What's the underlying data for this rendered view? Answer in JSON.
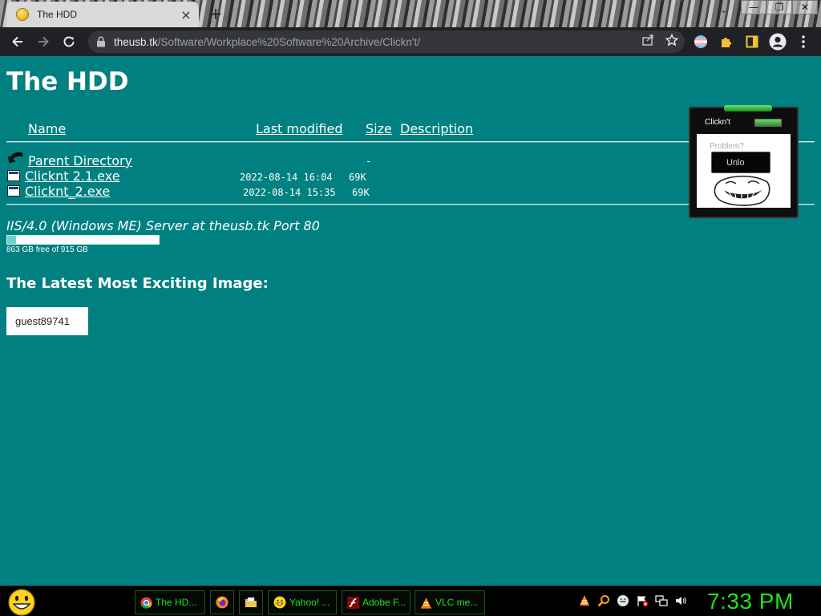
{
  "browser": {
    "tab_title": "The HDD",
    "tab_close": "×",
    "new_tab": "+",
    "url_host": "theusb.tk",
    "url_path": "/Software/Workplace%20Software%20Archive/Clickn't/"
  },
  "window_controls": {
    "minimize": "—",
    "maximize": "❐",
    "close": "✕"
  },
  "page": {
    "title": "The HDD",
    "columns": {
      "name": "Name",
      "last_modified": "Last modified",
      "size": "Size",
      "description": "Description"
    },
    "parent": {
      "label": "Parent Directory",
      "size": "-"
    },
    "files": [
      {
        "name": "Clicknt 2.1.exe",
        "modified": "2022-08-14 16:04",
        "size": "69K"
      },
      {
        "name": "Clicknt_2.exe",
        "modified": "2022-08-14 15:35",
        "size": "69K"
      }
    ],
    "server_signature": "IIS/4.0 (Windows ME) Server at theusb.tk Port 80",
    "disk": {
      "free_text": "863 GB free of 915 GB",
      "used_fraction": 0.057
    },
    "latest_heading": "The Latest Most Exciting Image:",
    "guest_label": "guest89741"
  },
  "widget": {
    "title": "Clickn't",
    "problem_text": "Problem?",
    "unlock_label": "Unlo"
  },
  "taskbar": {
    "tasks": [
      {
        "label": "The HD...",
        "icon": "chrome-icon"
      },
      {
        "label": "",
        "icon": "firefox-icon"
      },
      {
        "label": "",
        "icon": "folder-icon"
      },
      {
        "label": "Yahoo! ...",
        "icon": "yahoo-smiley-icon"
      },
      {
        "label": "Adobe F...",
        "icon": "adobe-flash-icon"
      },
      {
        "label": "VLC me...",
        "icon": "vlc-icon"
      }
    ],
    "clock": "7:33 PM"
  },
  "colors": {
    "page_bg": "#008080",
    "taskbar_text": "#19e619",
    "toolbar_bg": "#202124"
  }
}
